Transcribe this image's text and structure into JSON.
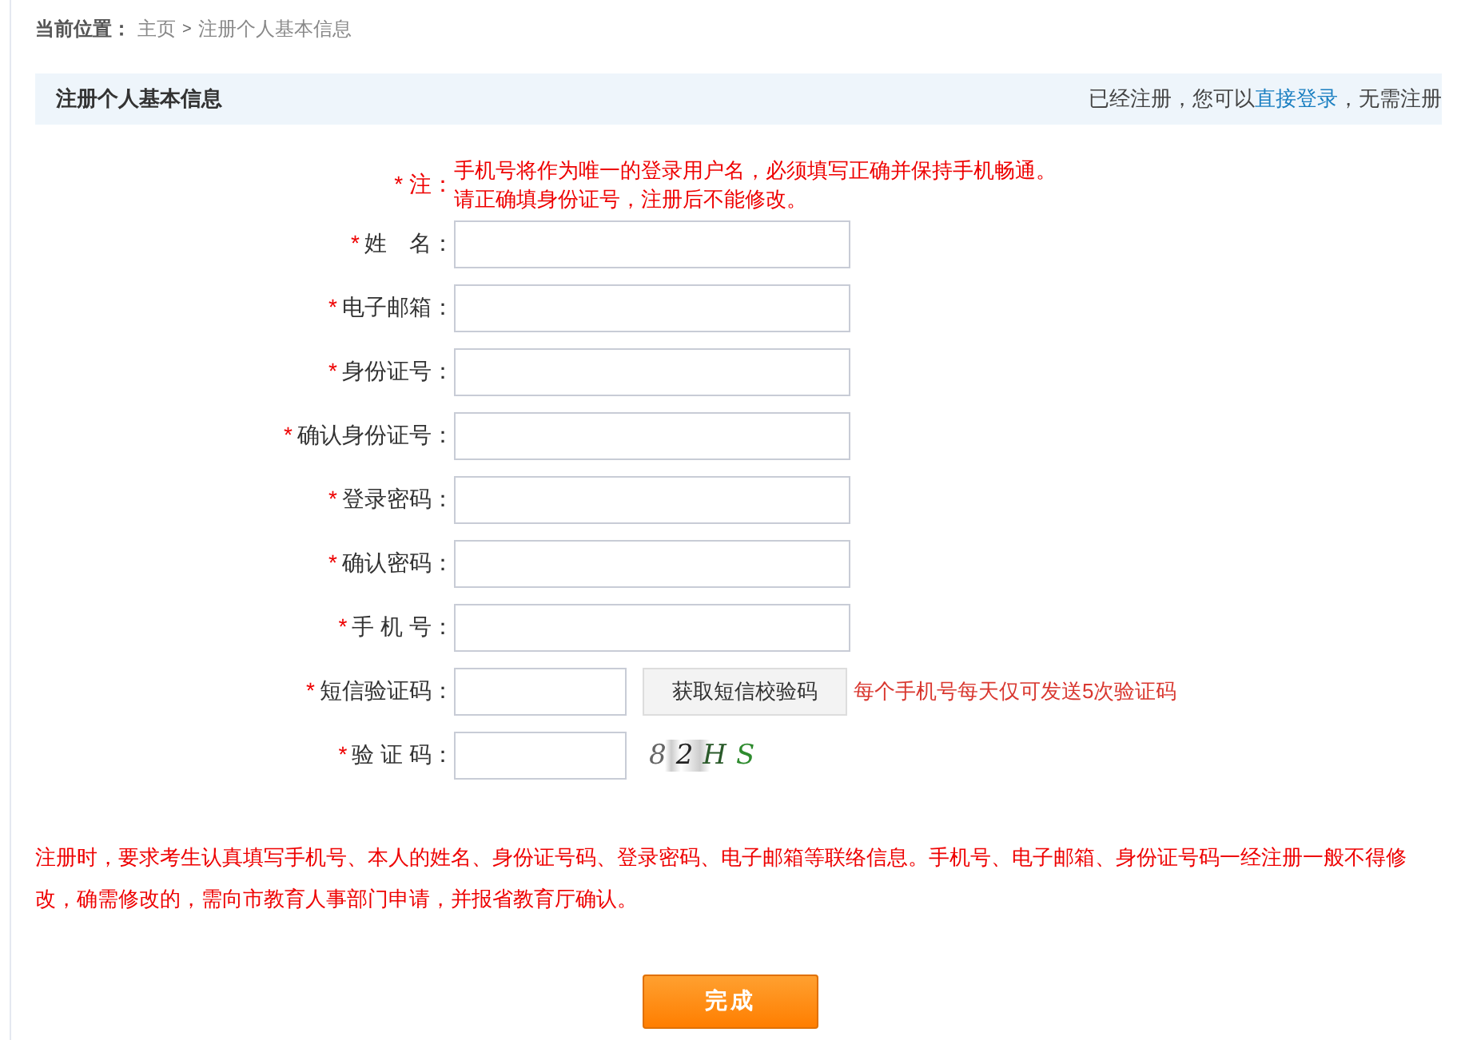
{
  "breadcrumb": {
    "label": "当前位置：",
    "items": [
      {
        "text": "主页"
      },
      {
        "text": "注册个人基本信息"
      }
    ],
    "separator": ">"
  },
  "header": {
    "title": "注册个人基本信息",
    "login_prefix": "已经注册，您可以",
    "login_link": "直接登录",
    "login_suffix": "，无需注册"
  },
  "notice": {
    "mark": "*",
    "label": "注：",
    "lines": [
      "手机号将作为唯一的登录用户名，必须填写正确并保持手机畅通。",
      "请正确填身份证号，注册后不能修改。"
    ]
  },
  "fields": [
    {
      "kind": "text",
      "mark": "*",
      "label": "姓　名："
    },
    {
      "kind": "text",
      "mark": "*",
      "label": "电子邮箱："
    },
    {
      "kind": "text",
      "mark": "*",
      "label": "身份证号："
    },
    {
      "kind": "text",
      "mark": "*",
      "label": "确认身份证号："
    },
    {
      "kind": "text",
      "mark": "*",
      "label": "登录密码："
    },
    {
      "kind": "text",
      "mark": "*",
      "label": "确认密码："
    },
    {
      "kind": "text",
      "mark": "*",
      "label": "手 机 号："
    },
    {
      "kind": "sms",
      "mark": "*",
      "label": "短信验证码：",
      "button": "获取短信校验码",
      "hint": "每个手机号每天仅可发送5次验证码"
    },
    {
      "kind": "captcha",
      "mark": "*",
      "label": "验 证 码：",
      "captcha": "82HS"
    }
  ],
  "footer_note": "注册时，要求考生认真填写手机号、本人的姓名、身份证号码、登录密码、电子邮箱等联络信息。手机号、电子邮箱、身份证号码一经注册一般不得修改，确需修改的，需向市教育人事部门申请，并报省教育厅确认。",
  "submit": "完成"
}
